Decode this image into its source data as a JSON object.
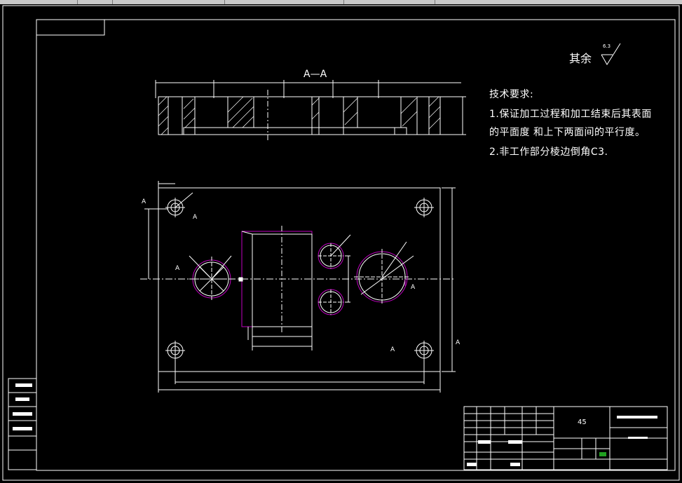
{
  "section_label": "A—A",
  "surface_note": "其余",
  "roughness_value": "6.3",
  "requirements": {
    "heading": "技术要求:",
    "line1": "1.保证加工过程和加工结束后其表面",
    "line2": "的平面度  和上下两面间的平行度。",
    "line3": "2.非工作部分棱边倒角C3."
  },
  "section_marks": {
    "a1": "A",
    "a2": "A",
    "a3": "A",
    "a4": "A",
    "a5": "A",
    "a6": "A"
  },
  "title_block": {
    "material": "45",
    "material_color": "#ffffff",
    "green_mark_color": "#20a020"
  },
  "colors": {
    "background": "#000000",
    "lines": "#ffffff",
    "hidden_parts": "#c000c0",
    "border": "#ffffff"
  }
}
